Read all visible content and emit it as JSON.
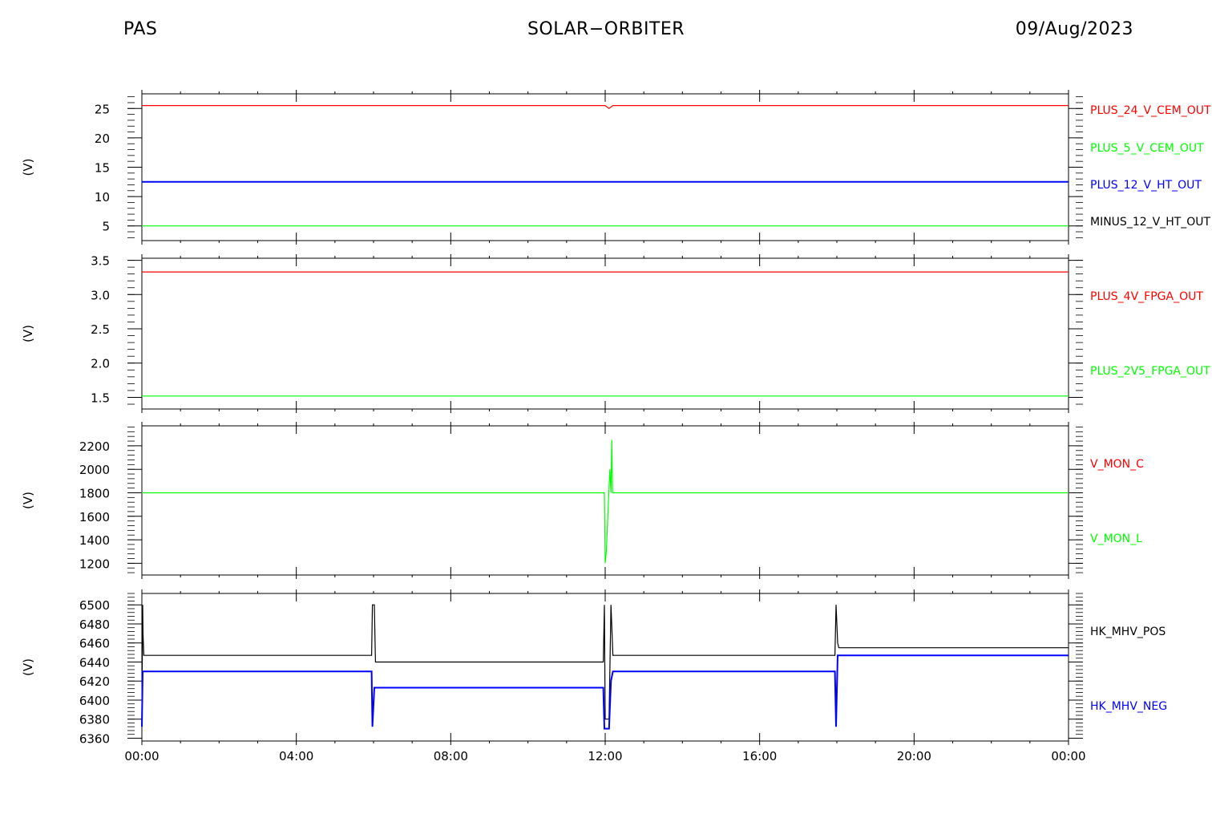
{
  "header": {
    "left": "PAS",
    "center": "SOLAR−ORBITER",
    "right": "09/Aug/2023"
  },
  "x_ticks": [
    "00:00",
    "04:00",
    "08:00",
    "12:00",
    "16:00",
    "20:00",
    "00:00"
  ],
  "chart_data": [
    {
      "type": "line",
      "ylabel": "(V)",
      "ylim": [
        2.5,
        27.5
      ],
      "yticks": [
        5,
        10,
        15,
        20,
        25
      ],
      "ytick_labels": [
        "5",
        "10",
        "15",
        "20",
        "25"
      ],
      "xlim": [
        0,
        24
      ],
      "series": [
        {
          "name": "PLUS_24_V_CEM_OUT",
          "color": "#ff0000",
          "x": [
            0,
            12.0,
            12.1,
            12.2,
            24
          ],
          "y": [
            25.5,
            25.5,
            25.0,
            25.5,
            25.5
          ]
        },
        {
          "name": "PLUS_5_V_CEM_OUT",
          "color": "#00ff00",
          "x": [
            0,
            24
          ],
          "y": [
            5.0,
            5.0
          ]
        },
        {
          "name": "PLUS_12_V_HT_OUT",
          "color": "#0000ff",
          "x": [
            0,
            24
          ],
          "y": [
            12.5,
            12.5
          ]
        },
        {
          "name": "MINUS_12_V_HT_OUT",
          "color": "#000000",
          "x": [],
          "y": []
        }
      ]
    },
    {
      "type": "line",
      "ylabel": "(V)",
      "ylim": [
        1.33,
        3.53
      ],
      "yticks": [
        1.5,
        2.0,
        2.5,
        3.0,
        3.5
      ],
      "ytick_labels": [
        "1.5",
        "2.0",
        "2.5",
        "3.0",
        "3.5"
      ],
      "xlim": [
        0,
        24
      ],
      "series": [
        {
          "name": "PLUS_4V_FPGA_OUT",
          "color": "#ff0000",
          "x": [
            0,
            24
          ],
          "y": [
            3.33,
            3.33
          ]
        },
        {
          "name": "PLUS_2V5_FPGA_OUT",
          "color": "#00ff00",
          "x": [
            0,
            24
          ],
          "y": [
            1.52,
            1.52
          ]
        }
      ]
    },
    {
      "type": "line",
      "ylabel": "(V)",
      "ylim": [
        1100,
        2370
      ],
      "yticks": [
        1200,
        1400,
        1600,
        1800,
        2000,
        2200
      ],
      "ytick_labels": [
        "1200",
        "1400",
        "1600",
        "1800",
        "2000",
        "2200"
      ],
      "xlim": [
        0,
        24
      ],
      "series": [
        {
          "name": "V_MON_C",
          "color": "#ff0000",
          "x": [],
          "y": []
        },
        {
          "name": "V_MON_L",
          "color": "#00ff00",
          "x": [
            0,
            11.98,
            12.0,
            12.03,
            12.08,
            12.12,
            12.15,
            12.17,
            12.19,
            12.21,
            24
          ],
          "y": [
            1800,
            1800,
            1200,
            1300,
            1700,
            2000,
            1800,
            2250,
            1800,
            1800,
            1800
          ]
        }
      ]
    },
    {
      "type": "line",
      "ylabel": "(V)",
      "ylim": [
        6357,
        6512
      ],
      "yticks": [
        6360,
        6380,
        6400,
        6420,
        6440,
        6460,
        6480,
        6500
      ],
      "ytick_labels": [
        "6360",
        "6380",
        "6400",
        "6420",
        "6440",
        "6460",
        "6480",
        "6500"
      ],
      "xlim": [
        0,
        24
      ],
      "series": [
        {
          "name": "HK_MHV_POS",
          "color": "#000000",
          "x": [
            0,
            0.02,
            0.03,
            0.05,
            5.95,
            5.97,
            6.02,
            6.05,
            6.08,
            11.95,
            11.98,
            12.0,
            12.1,
            12.15,
            12.2,
            17.95,
            17.98,
            18.02,
            18.05,
            24
          ],
          "y": [
            6380,
            6500,
            6470,
            6447,
            6447,
            6500,
            6500,
            6440,
            6440,
            6440,
            6500,
            6380,
            6380,
            6500,
            6447,
            6447,
            6500,
            6460,
            6455,
            6455
          ]
        },
        {
          "name": "HK_MHV_NEG",
          "color": "#0000ff",
          "x": [
            0,
            0.02,
            0.04,
            5.95,
            5.97,
            6.02,
            6.05,
            11.95,
            11.98,
            12.0,
            12.1,
            12.15,
            12.2,
            17.95,
            17.98,
            18.02,
            24
          ],
          "y": [
            6372,
            6430,
            6430,
            6430,
            6372,
            6413,
            6413,
            6413,
            6370,
            6370,
            6370,
            6420,
            6430,
            6430,
            6372,
            6447,
            6447
          ]
        }
      ]
    }
  ]
}
